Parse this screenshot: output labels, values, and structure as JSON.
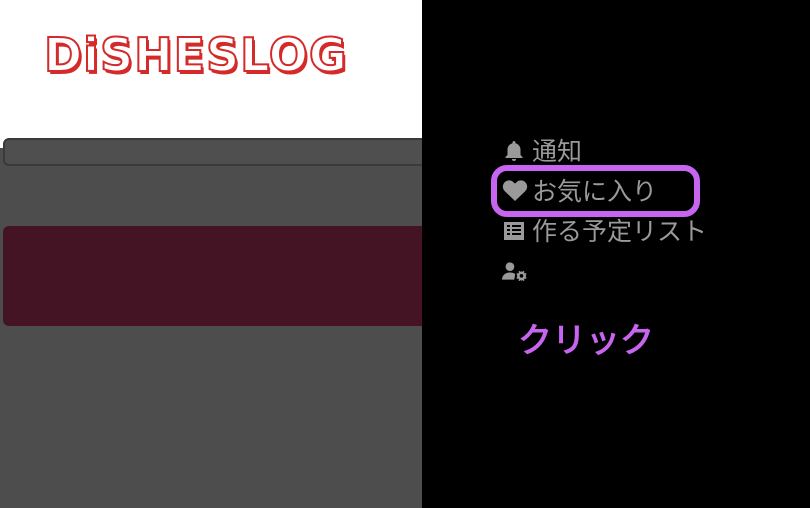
{
  "header": {
    "logo_text": "DiSHESLOG"
  },
  "menu": {
    "items": [
      {
        "label": "通知",
        "icon": "bell-icon"
      },
      {
        "label": "お気に入り",
        "icon": "heart-icon"
      },
      {
        "label": "作る予定リスト",
        "icon": "list-icon"
      },
      {
        "label": "",
        "icon": "user-settings-icon"
      }
    ]
  },
  "annotation": {
    "text": "クリック",
    "color": "#c865f0"
  },
  "colors": {
    "logo": "#d42a2a",
    "banner": "#451424",
    "menu_bg": "#000000",
    "menu_text": "#9a9a9a"
  }
}
